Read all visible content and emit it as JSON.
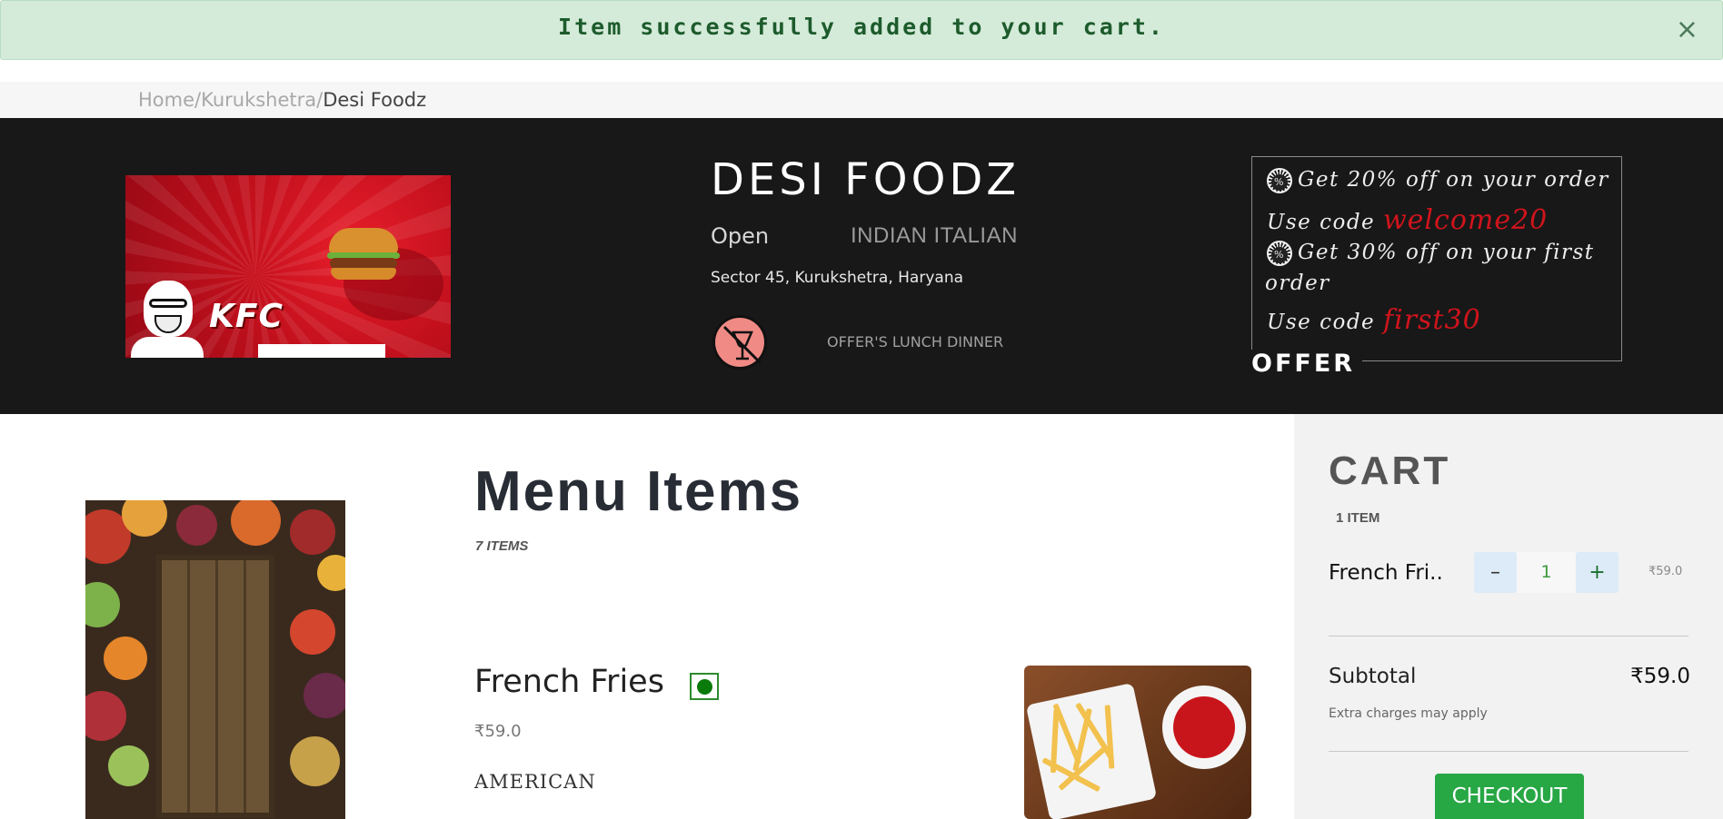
{
  "alert": {
    "message": "Item successfully added to your cart.",
    "close_glyph": "×",
    "color": "#d4ebd9"
  },
  "breadcrumb": {
    "home": "Home",
    "separator": "/",
    "city": "Kurukshetra",
    "current": "Desi Foodz"
  },
  "restaurant": {
    "banner_logo_text": "KFC",
    "name": "DESI FOODZ",
    "status": "Open",
    "cuisine": "INDIAN ITALIAN",
    "address": "Sector 45, Kurukshetra, Haryana",
    "tags": "OFFER'S LUNCH DINNER",
    "icon": "no-alcohol-icon"
  },
  "offers": {
    "label": "OFFER",
    "line1": "Get 20% off on your order",
    "line2_prefix": "Use code",
    "code1": "welcome20",
    "line3a": "Get 30% off on your first",
    "line3b": "order",
    "line4_prefix": "Use code",
    "code2": "first30",
    "icon": "discount-icon",
    "code_color": "#d0141c"
  },
  "menu": {
    "title": "Menu Items",
    "count": "7 ITEMS",
    "items": [
      {
        "name": "French Fries",
        "price": "₹59.0",
        "cuisine": "AMERICAN",
        "veg": true,
        "veg_color": "#0a7a0a"
      }
    ]
  },
  "cart": {
    "title": "CART",
    "count": "1 ITEM",
    "items": [
      {
        "name": "French Fri..",
        "minus": "–",
        "quantity": "1",
        "plus": "+",
        "price": "₹59.0"
      }
    ],
    "subtotal_label": "Subtotal",
    "subtotal_value": "₹59.0",
    "extra_note": "Extra charges may apply",
    "checkout_label": "CHECKOUT",
    "checkout_color": "#28a745"
  }
}
